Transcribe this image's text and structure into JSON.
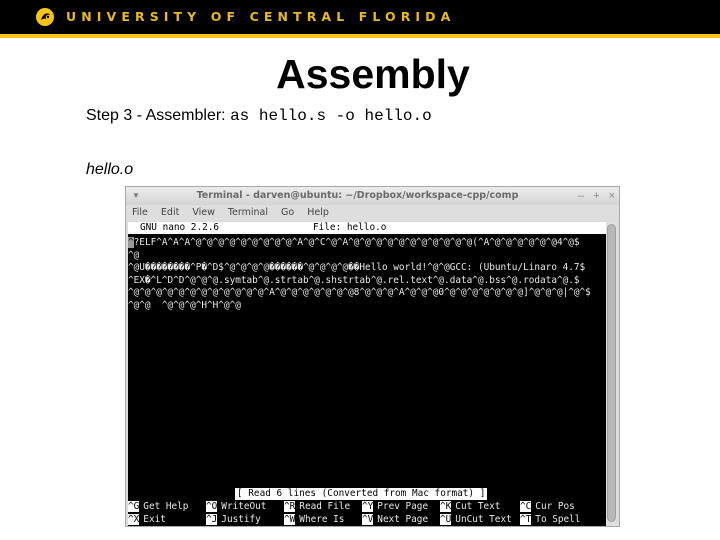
{
  "banner": {
    "text": "UNIVERSITY OF CENTRAL FLORIDA",
    "logo_icon": "pegasus-logo-icon",
    "text_color": "#e8b923",
    "stripe_color": "#f5c518"
  },
  "slide": {
    "title": "Assembly",
    "step_label": "Step 3 - Assembler: ",
    "step_command": "as hello.s -o hello.o",
    "file_caption": "hello.o"
  },
  "terminal": {
    "window_title": "Terminal - darven@ubuntu: ~/Dropbox/workspace-cpp/comp",
    "window_controls": [
      "–",
      "+",
      "×"
    ],
    "menu": [
      "File",
      "Edit",
      "View",
      "Terminal",
      "Go",
      "Help"
    ],
    "nano": {
      "version": "GNU nano 2.2.6",
      "file_label": "File: hello.o",
      "cursor_char": "^",
      "lines": [
        "?ELF^A^A^A^@^@^@^@^@^@^@^@^@^A^@^C^@^A^@^@^@^@^@^@^@^@^@^@^@(^A^@^@^@^@^@^@4^@$",
        "^@",
        "^@U��������^P�^D$^@^@^@^@������^@^@^@^@��Hello world!^@^@GCC: (Ubuntu/Linaro 4.7$",
        "^EX�^L^D^D^@^@^@.symtab^@.strtab^@.shstrtab^@.rel.text^@.data^@.bss^@.rodata^@.$",
        "^@^@^@^@^@^@^@^@^@^@^@^@^A^@^@^@^@^@^@^@8^@^@^@^A^@^@^@0^@^@^@^@^@^@^@]^@^@^@|^@^$",
        "^@^@  ^@^@^@^H^H^@^@"
      ],
      "status_message": "[ Read 6 lines (Converted from Mac format) ]",
      "shortcuts_row1": [
        {
          "key": "^G",
          "label": "Get Help"
        },
        {
          "key": "^O",
          "label": "WriteOut"
        },
        {
          "key": "^R",
          "label": "Read File"
        },
        {
          "key": "^Y",
          "label": "Prev Page"
        },
        {
          "key": "^K",
          "label": "Cut Text"
        },
        {
          "key": "^C",
          "label": "Cur Pos"
        }
      ],
      "shortcuts_row2": [
        {
          "key": "^X",
          "label": "Exit"
        },
        {
          "key": "^J",
          "label": "Justify"
        },
        {
          "key": "^W",
          "label": "Where Is"
        },
        {
          "key": "^V",
          "label": "Next Page"
        },
        {
          "key": "^U",
          "label": "UnCut Text"
        },
        {
          "key": "^T",
          "label": "To Spell"
        }
      ]
    }
  }
}
